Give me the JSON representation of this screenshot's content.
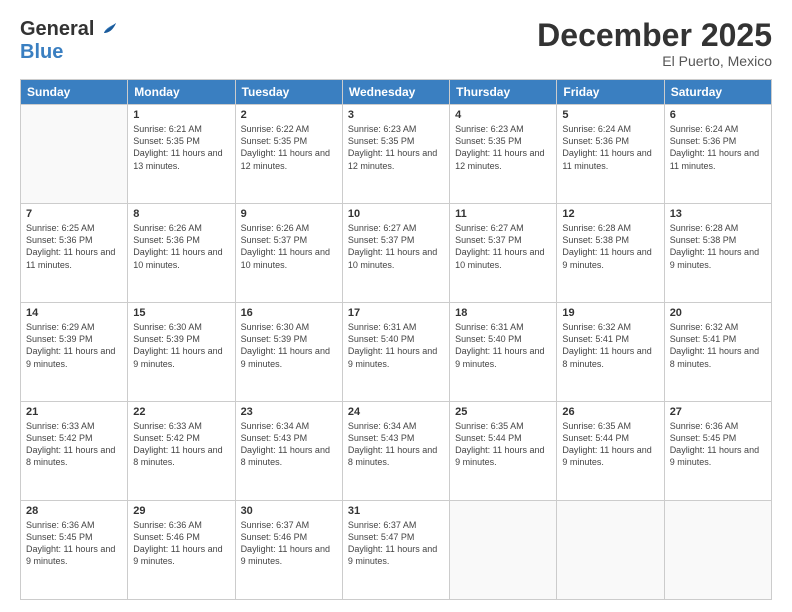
{
  "header": {
    "logo_general": "General",
    "logo_blue": "Blue",
    "month_title": "December 2025",
    "location": "El Puerto, Mexico"
  },
  "weekdays": [
    "Sunday",
    "Monday",
    "Tuesday",
    "Wednesday",
    "Thursday",
    "Friday",
    "Saturday"
  ],
  "weeks": [
    [
      {
        "day": "",
        "sunrise": "",
        "sunset": "",
        "daylight": ""
      },
      {
        "day": "1",
        "sunrise": "Sunrise: 6:21 AM",
        "sunset": "Sunset: 5:35 PM",
        "daylight": "Daylight: 11 hours and 13 minutes."
      },
      {
        "day": "2",
        "sunrise": "Sunrise: 6:22 AM",
        "sunset": "Sunset: 5:35 PM",
        "daylight": "Daylight: 11 hours and 12 minutes."
      },
      {
        "day": "3",
        "sunrise": "Sunrise: 6:23 AM",
        "sunset": "Sunset: 5:35 PM",
        "daylight": "Daylight: 11 hours and 12 minutes."
      },
      {
        "day": "4",
        "sunrise": "Sunrise: 6:23 AM",
        "sunset": "Sunset: 5:35 PM",
        "daylight": "Daylight: 11 hours and 12 minutes."
      },
      {
        "day": "5",
        "sunrise": "Sunrise: 6:24 AM",
        "sunset": "Sunset: 5:36 PM",
        "daylight": "Daylight: 11 hours and 11 minutes."
      },
      {
        "day": "6",
        "sunrise": "Sunrise: 6:24 AM",
        "sunset": "Sunset: 5:36 PM",
        "daylight": "Daylight: 11 hours and 11 minutes."
      }
    ],
    [
      {
        "day": "7",
        "sunrise": "Sunrise: 6:25 AM",
        "sunset": "Sunset: 5:36 PM",
        "daylight": "Daylight: 11 hours and 11 minutes."
      },
      {
        "day": "8",
        "sunrise": "Sunrise: 6:26 AM",
        "sunset": "Sunset: 5:36 PM",
        "daylight": "Daylight: 11 hours and 10 minutes."
      },
      {
        "day": "9",
        "sunrise": "Sunrise: 6:26 AM",
        "sunset": "Sunset: 5:37 PM",
        "daylight": "Daylight: 11 hours and 10 minutes."
      },
      {
        "day": "10",
        "sunrise": "Sunrise: 6:27 AM",
        "sunset": "Sunset: 5:37 PM",
        "daylight": "Daylight: 11 hours and 10 minutes."
      },
      {
        "day": "11",
        "sunrise": "Sunrise: 6:27 AM",
        "sunset": "Sunset: 5:37 PM",
        "daylight": "Daylight: 11 hours and 10 minutes."
      },
      {
        "day": "12",
        "sunrise": "Sunrise: 6:28 AM",
        "sunset": "Sunset: 5:38 PM",
        "daylight": "Daylight: 11 hours and 9 minutes."
      },
      {
        "day": "13",
        "sunrise": "Sunrise: 6:28 AM",
        "sunset": "Sunset: 5:38 PM",
        "daylight": "Daylight: 11 hours and 9 minutes."
      }
    ],
    [
      {
        "day": "14",
        "sunrise": "Sunrise: 6:29 AM",
        "sunset": "Sunset: 5:39 PM",
        "daylight": "Daylight: 11 hours and 9 minutes."
      },
      {
        "day": "15",
        "sunrise": "Sunrise: 6:30 AM",
        "sunset": "Sunset: 5:39 PM",
        "daylight": "Daylight: 11 hours and 9 minutes."
      },
      {
        "day": "16",
        "sunrise": "Sunrise: 6:30 AM",
        "sunset": "Sunset: 5:39 PM",
        "daylight": "Daylight: 11 hours and 9 minutes."
      },
      {
        "day": "17",
        "sunrise": "Sunrise: 6:31 AM",
        "sunset": "Sunset: 5:40 PM",
        "daylight": "Daylight: 11 hours and 9 minutes."
      },
      {
        "day": "18",
        "sunrise": "Sunrise: 6:31 AM",
        "sunset": "Sunset: 5:40 PM",
        "daylight": "Daylight: 11 hours and 9 minutes."
      },
      {
        "day": "19",
        "sunrise": "Sunrise: 6:32 AM",
        "sunset": "Sunset: 5:41 PM",
        "daylight": "Daylight: 11 hours and 8 minutes."
      },
      {
        "day": "20",
        "sunrise": "Sunrise: 6:32 AM",
        "sunset": "Sunset: 5:41 PM",
        "daylight": "Daylight: 11 hours and 8 minutes."
      }
    ],
    [
      {
        "day": "21",
        "sunrise": "Sunrise: 6:33 AM",
        "sunset": "Sunset: 5:42 PM",
        "daylight": "Daylight: 11 hours and 8 minutes."
      },
      {
        "day": "22",
        "sunrise": "Sunrise: 6:33 AM",
        "sunset": "Sunset: 5:42 PM",
        "daylight": "Daylight: 11 hours and 8 minutes."
      },
      {
        "day": "23",
        "sunrise": "Sunrise: 6:34 AM",
        "sunset": "Sunset: 5:43 PM",
        "daylight": "Daylight: 11 hours and 8 minutes."
      },
      {
        "day": "24",
        "sunrise": "Sunrise: 6:34 AM",
        "sunset": "Sunset: 5:43 PM",
        "daylight": "Daylight: 11 hours and 8 minutes."
      },
      {
        "day": "25",
        "sunrise": "Sunrise: 6:35 AM",
        "sunset": "Sunset: 5:44 PM",
        "daylight": "Daylight: 11 hours and 9 minutes."
      },
      {
        "day": "26",
        "sunrise": "Sunrise: 6:35 AM",
        "sunset": "Sunset: 5:44 PM",
        "daylight": "Daylight: 11 hours and 9 minutes."
      },
      {
        "day": "27",
        "sunrise": "Sunrise: 6:36 AM",
        "sunset": "Sunset: 5:45 PM",
        "daylight": "Daylight: 11 hours and 9 minutes."
      }
    ],
    [
      {
        "day": "28",
        "sunrise": "Sunrise: 6:36 AM",
        "sunset": "Sunset: 5:45 PM",
        "daylight": "Daylight: 11 hours and 9 minutes."
      },
      {
        "day": "29",
        "sunrise": "Sunrise: 6:36 AM",
        "sunset": "Sunset: 5:46 PM",
        "daylight": "Daylight: 11 hours and 9 minutes."
      },
      {
        "day": "30",
        "sunrise": "Sunrise: 6:37 AM",
        "sunset": "Sunset: 5:46 PM",
        "daylight": "Daylight: 11 hours and 9 minutes."
      },
      {
        "day": "31",
        "sunrise": "Sunrise: 6:37 AM",
        "sunset": "Sunset: 5:47 PM",
        "daylight": "Daylight: 11 hours and 9 minutes."
      },
      {
        "day": "",
        "sunrise": "",
        "sunset": "",
        "daylight": ""
      },
      {
        "day": "",
        "sunrise": "",
        "sunset": "",
        "daylight": ""
      },
      {
        "day": "",
        "sunrise": "",
        "sunset": "",
        "daylight": ""
      }
    ]
  ]
}
